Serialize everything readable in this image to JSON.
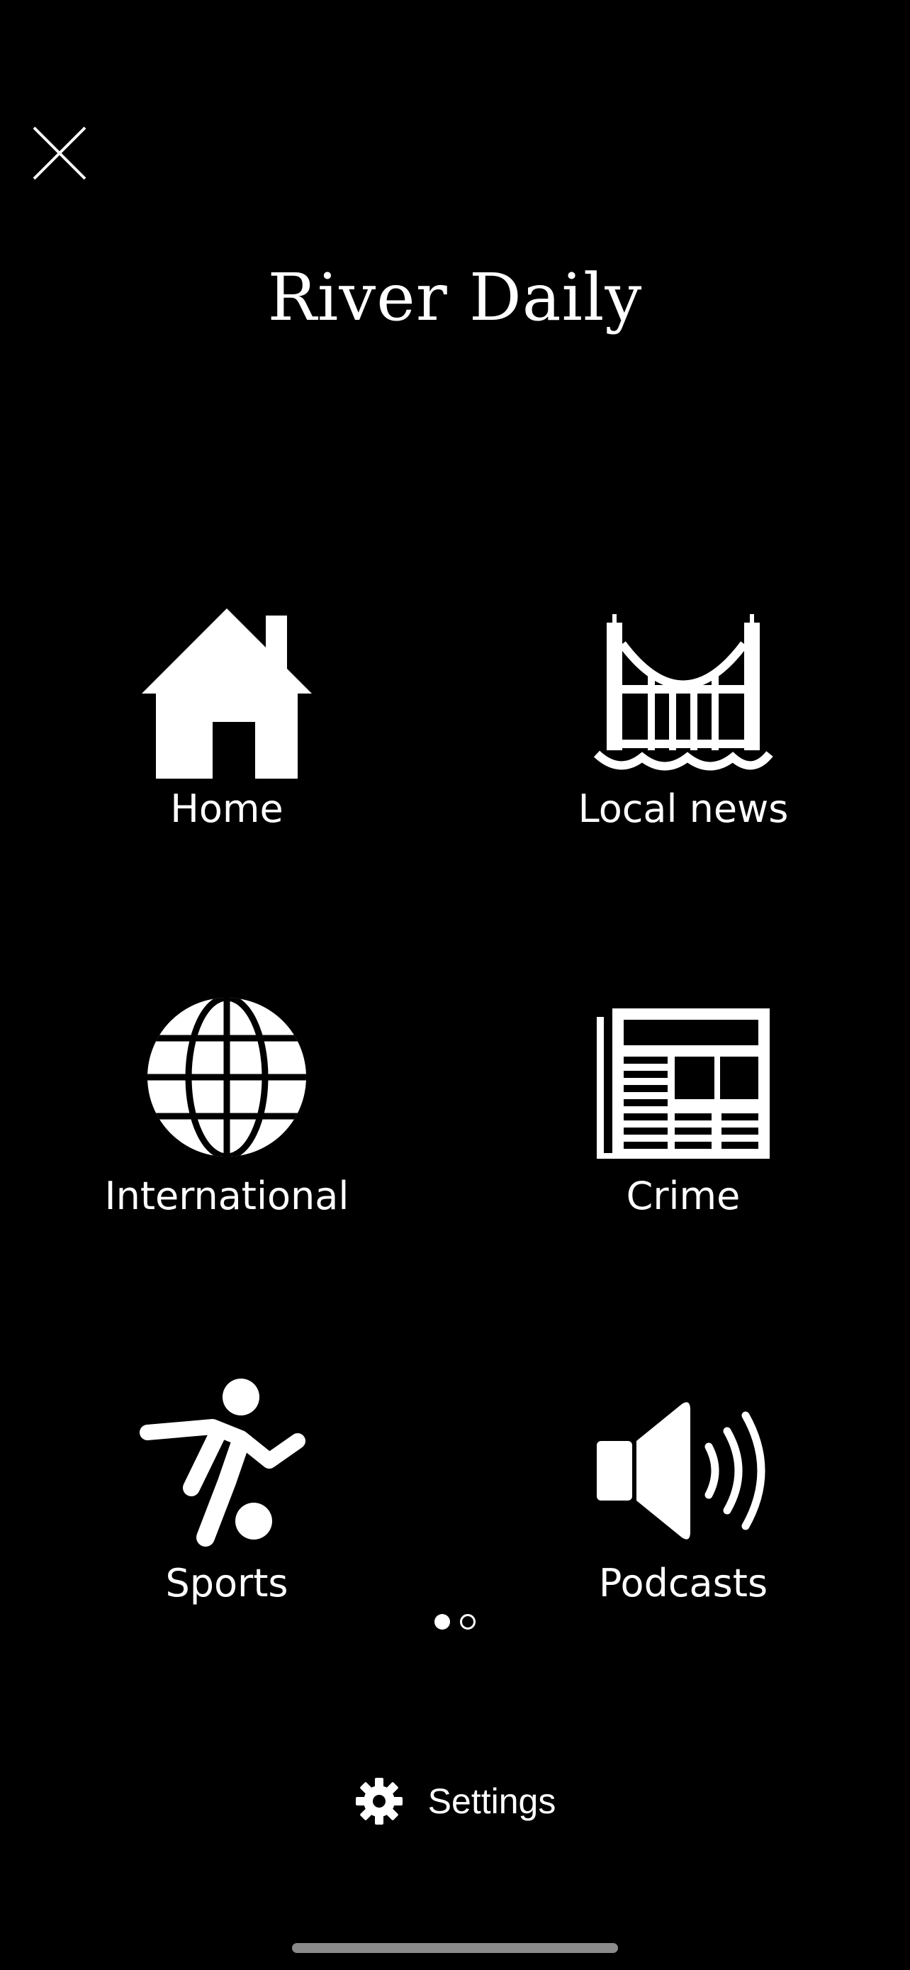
{
  "header": {
    "title": "River Daily",
    "close_icon": "close-icon"
  },
  "menu": [
    {
      "key": "home",
      "label": "Home",
      "icon": "house-icon"
    },
    {
      "key": "local-news",
      "label": "Local news",
      "icon": "bridge-icon"
    },
    {
      "key": "international",
      "label": "International",
      "icon": "globe-icon"
    },
    {
      "key": "crime",
      "label": "Crime",
      "icon": "newspaper-icon"
    },
    {
      "key": "sports",
      "label": "Sports",
      "icon": "soccer-player-icon"
    },
    {
      "key": "podcasts",
      "label": "Podcasts",
      "icon": "speaker-icon"
    }
  ],
  "pagination": {
    "pages": 2,
    "current": 1
  },
  "footer": {
    "settings_label": "Settings",
    "settings_icon": "gear-icon"
  },
  "colors": {
    "background": "#000000",
    "foreground": "#ffffff",
    "home_indicator": "#8a8a8a"
  }
}
